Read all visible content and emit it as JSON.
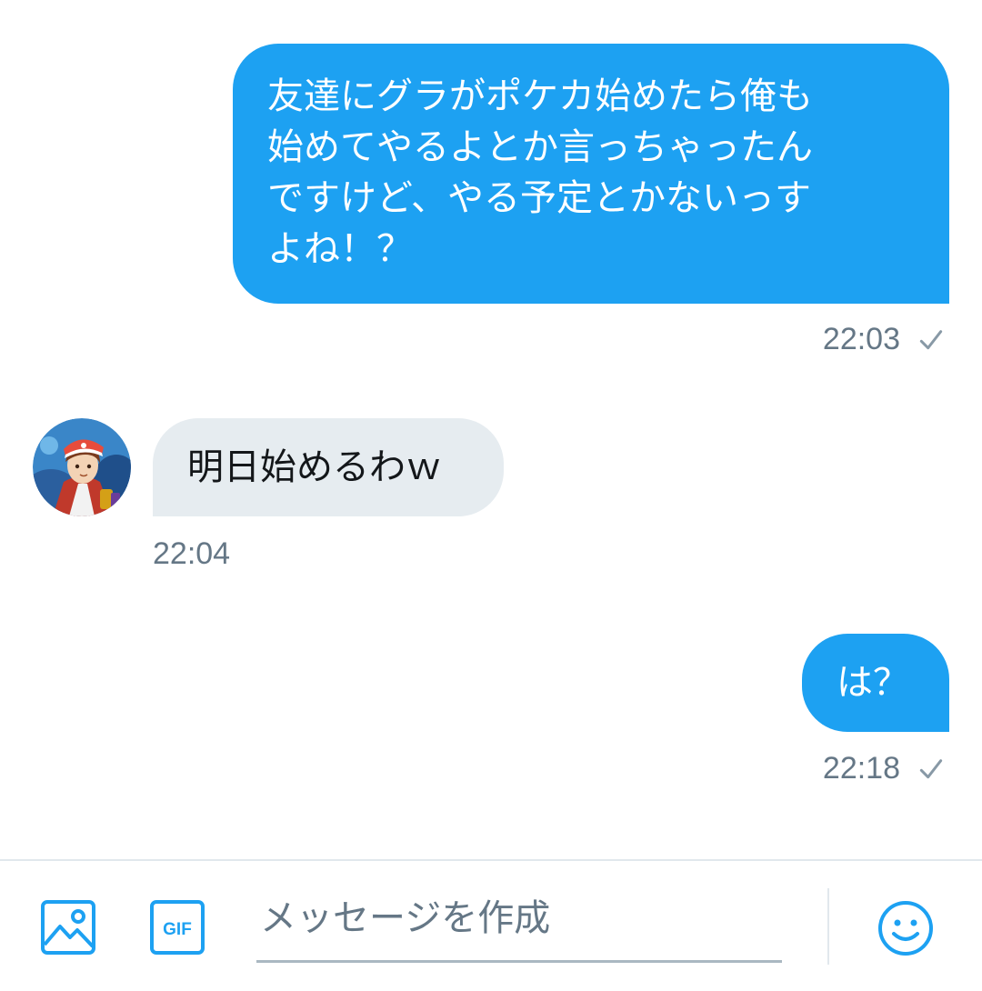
{
  "messages": [
    {
      "direction": "sent",
      "text": "友達にグラがポケカ始めたら俺も\n始めてやるよとか言っちゃったん\nですけど、やる予定とかないっす\nよね！？",
      "time": "22:03",
      "read_icon": "check-icon"
    },
    {
      "direction": "received",
      "text": "明日始めるわｗ",
      "time": "22:04",
      "avatar_icon": "avatar-anime-character"
    },
    {
      "direction": "sent",
      "text": "は？",
      "time": "22:18",
      "read_icon": "check-icon"
    }
  ],
  "composer": {
    "placeholder": "メッセージを作成",
    "value": "",
    "image_button_icon": "image-icon",
    "gif_button_icon": "gif-icon",
    "gif_label": "GIF",
    "emoji_button_icon": "emoji-icon"
  },
  "colors": {
    "accent": "#1da1f2",
    "received_bubble": "#e6ecf0",
    "meta_text": "#657786",
    "divider": "#e1e8ed"
  }
}
